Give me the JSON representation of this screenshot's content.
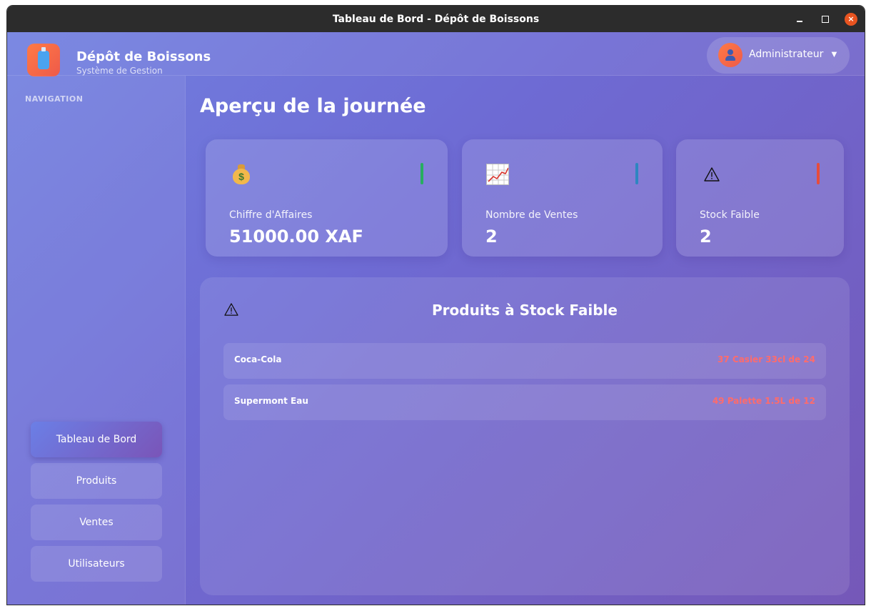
{
  "window": {
    "title": "Tableau de Bord - Dépôt de Boissons",
    "controls": {
      "minimize": "minimize-icon",
      "maximize": "maximize-icon",
      "close": "×"
    }
  },
  "header": {
    "brand_title": "Dépôt de Boissons",
    "brand_subtitle": "Système de Gestion",
    "logo_icon": "bottle-icon",
    "user": {
      "name": "Administrateur",
      "caret": "▼",
      "avatar_icon": "user-avatar-icon"
    }
  },
  "sidebar": {
    "heading": "NAVIGATION",
    "items": [
      {
        "label": "Tableau de Bord",
        "active": true
      },
      {
        "label": "Produits",
        "active": false
      },
      {
        "label": "Ventes",
        "active": false
      },
      {
        "label": "Utilisateurs",
        "active": false
      }
    ]
  },
  "main": {
    "title": "Aperçu de la journée",
    "stats": [
      {
        "icon": "money-bag-icon",
        "label": "Chiffre d'Affaires",
        "value": "51000.00 XAF",
        "accent": "#27ae60"
      },
      {
        "icon": "chart-increasing-icon",
        "label": "Nombre de Ventes",
        "value": "2",
        "accent": "#2e86c1"
      },
      {
        "icon": "warning-icon",
        "label": "Stock Faible",
        "value": "2",
        "accent": "#e74c3c"
      }
    ],
    "low_stock": {
      "icon": "warning-icon",
      "title": "Produits à Stock Faible",
      "items": [
        {
          "name": "Coca-Cola",
          "quantity": "37 Casier 33cl de 24"
        },
        {
          "name": "Supermont Eau",
          "quantity": "49 Palette 1.5L de 12"
        }
      ]
    }
  },
  "colors": {
    "background_start": "#7180e0",
    "background_end": "#7558b8",
    "low_stock_text": "#ff6b6b",
    "close_button": "#e95420"
  }
}
